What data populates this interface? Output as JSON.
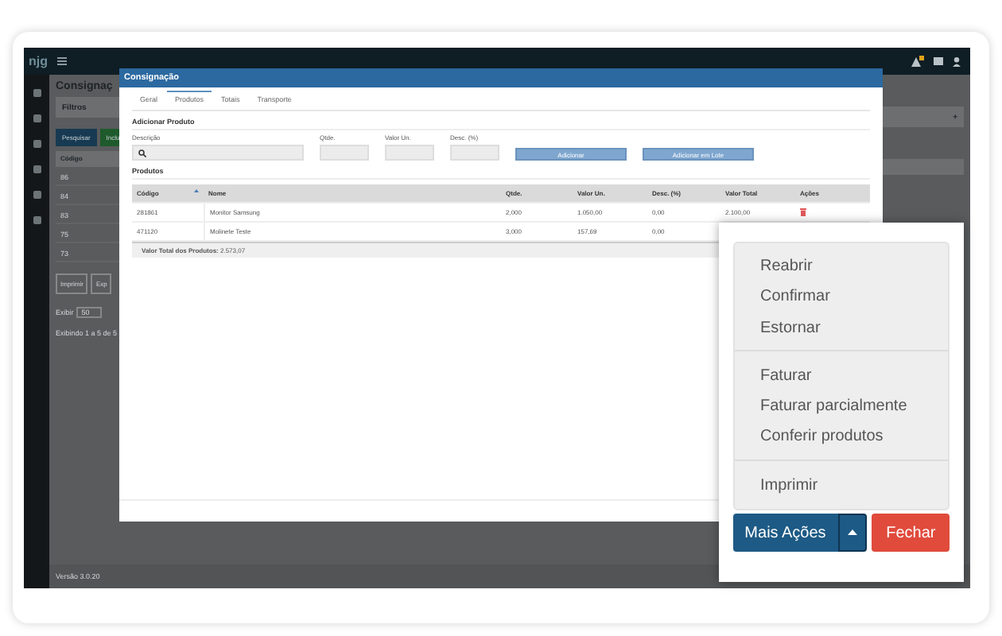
{
  "app": {
    "logo": "njg"
  },
  "background": {
    "title": "Consignaç",
    "filters": "Filtros",
    "buttons": [
      "Pesquisar",
      "Inclu"
    ],
    "column": "Código",
    "rows": [
      "86",
      "84",
      "83",
      "75",
      "73"
    ],
    "export_buttons": [
      "Imprimir",
      "Exp"
    ],
    "show_label": "Exibir",
    "page_size": "50",
    "summary": "Exibindo 1 a 5 de 5",
    "version": "Versão 3.0.20",
    "panel_action": "+"
  },
  "modal": {
    "title": "Consignação",
    "tabs": [
      {
        "label": "Geral",
        "selected": false
      },
      {
        "label": "Produtos",
        "selected": true
      },
      {
        "label": "Totais",
        "selected": false
      },
      {
        "label": "Transporte",
        "selected": false
      }
    ],
    "add_section": "Adicionar Produto",
    "fields": [
      {
        "label": "Descrição",
        "kind": "search"
      },
      {
        "label": "Qtde.",
        "kind": "plain"
      },
      {
        "label": "Valor Un.",
        "kind": "plain"
      },
      {
        "label": "Desc. (%)",
        "kind": "plain"
      }
    ],
    "buttons": [
      "Adicionar",
      "Adicionar em Lote"
    ],
    "products_title": "Produtos",
    "table": {
      "columns": [
        {
          "label": "Código",
          "sorted": true
        },
        {
          "label": "Nome",
          "sorted": false
        },
        {
          "label": "Qtde.",
          "sorted": false
        },
        {
          "label": "Valor Un.",
          "sorted": false
        },
        {
          "label": "Desc. (%)",
          "sorted": false
        },
        {
          "label": "Valor Total",
          "sorted": false
        },
        {
          "label": "Ações",
          "sorted": false
        }
      ],
      "rows": [
        {
          "cells": [
            "281861",
            "Monitor Samsung",
            "2,000",
            "1.050,00",
            "0,00",
            "2.100,00"
          ],
          "delete_action": true
        },
        {
          "cells": [
            "471120",
            "Molinete Teste",
            "3,000",
            "157,69",
            "0,00"
          ]
        }
      ]
    },
    "total": {
      "label": "Valor Total dos Produtos:",
      "value": "2.573,07"
    }
  },
  "callout": {
    "menu_groups": [
      [
        "Reabrir",
        "Confirmar",
        "Estornar"
      ],
      [
        "Faturar",
        "Faturar parcialmente",
        "Conferir produtos"
      ],
      [
        "Imprimir"
      ]
    ],
    "more_button": "Mais Ações",
    "close_button": "Fechar"
  }
}
